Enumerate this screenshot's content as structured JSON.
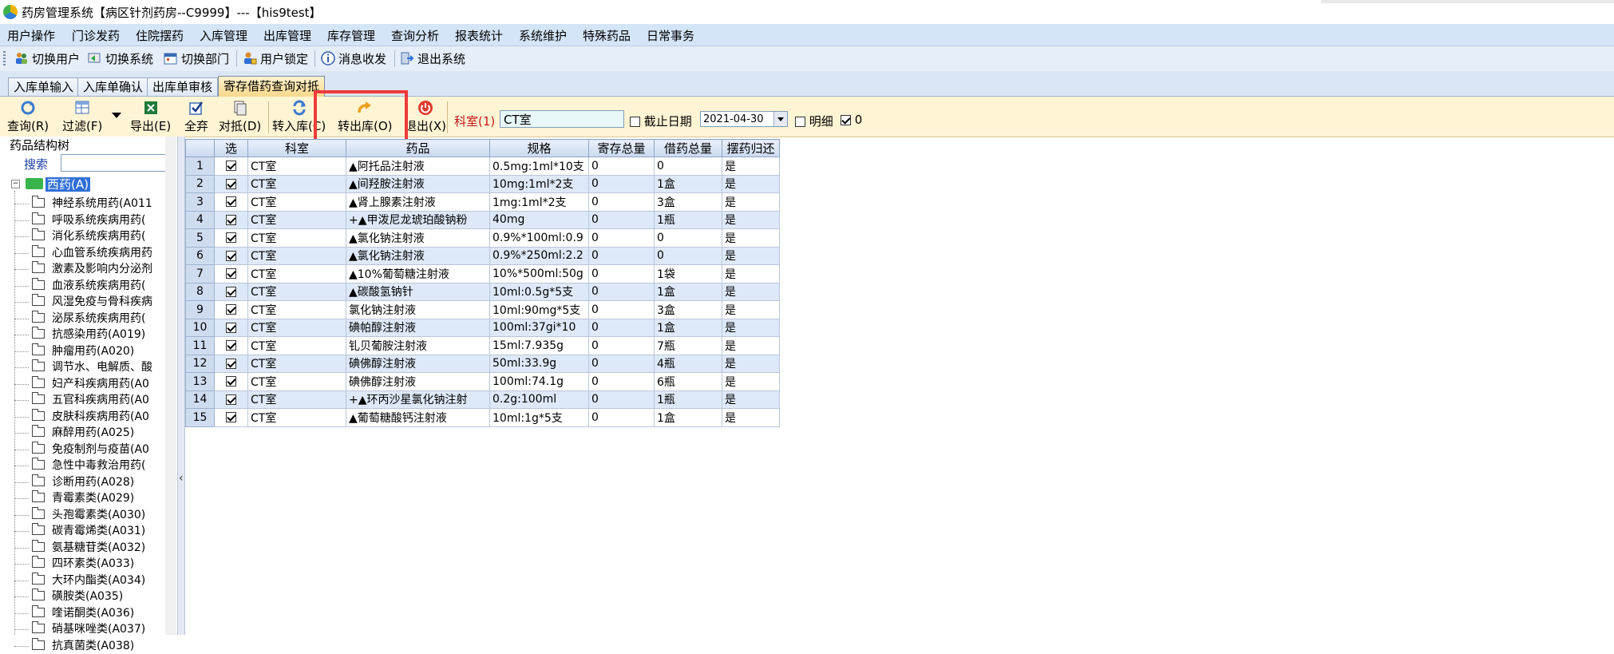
{
  "window": {
    "title": "药房管理系统【病区针剂药房--C9999】---【his9test】"
  },
  "menu": [
    "用户操作",
    "门诊发药",
    "住院摆药",
    "入库管理",
    "出库管理",
    "库存管理",
    "查询分析",
    "报表统计",
    "系统维护",
    "特殊药品",
    "日常事务"
  ],
  "toolbar1": [
    "切换用户",
    "切换系统",
    "切换部门",
    "用户锁定",
    "消息收发",
    "退出系统"
  ],
  "tabs": [
    "入库单输入",
    "入库单确认",
    "出库单审核",
    "寄存借药查询对抵"
  ],
  "toolbar2": {
    "query": "查询(R)",
    "filter": "过滤(F)",
    "export": "导出(E)",
    "select_all": "全弃",
    "reconcile": "对抵(D)",
    "transfer_in": "转入库(C)",
    "transfer_out": "转出库(O)",
    "exit": "退出(X)",
    "dept_label": "科室(1)",
    "dept_value": "CT室",
    "end_date_label": "截止日期",
    "end_date_value": "2021-04-30",
    "detail_label": "明细",
    "zero_label": "0"
  },
  "left_panel": {
    "title": "药品结构树",
    "search_label": "搜索",
    "root": "西药(A)",
    "items": [
      "神经系统用药(A011",
      "呼吸系统疾病用药(",
      "消化系统疾病用药(",
      "心血管系统疾病用药",
      "激素及影响内分泌剂",
      "血液系统疾病用药(",
      "风湿免疫与骨科疾病",
      "泌尿系统疾病用药(",
      "抗感染用药(A019)",
      "肿瘤用药(A020)",
      "调节水、电解质、酸",
      "妇产科疾病用药(A0",
      "五官科疾病用药(A0",
      "皮肤科疾病用药(A0",
      "麻醉用药(A025)",
      "免疫制剂与疫苗(A0",
      "急性中毒救治用药(",
      "诊断用药(A028)",
      "青霉素类(A029)",
      "头孢霉素类(A030)",
      "碳青霉烯类(A031)",
      "氨基糖苷类(A032)",
      "四环素类(A033)",
      "大环内酯类(A034)",
      "磺胺类(A035)",
      "喹诺酮类(A036)",
      "硝基咪唑类(A037)",
      "抗真菌类(A038)"
    ]
  },
  "grid": {
    "columns": [
      "选",
      "科室",
      "药品",
      "规格",
      "寄存总量",
      "借药总量",
      "摆药归还"
    ],
    "rows": [
      [
        "1",
        "CT室",
        "▲阿托品注射液",
        "0.5mg:1ml*10支",
        "0",
        "0",
        "是"
      ],
      [
        "2",
        "CT室",
        "▲间羟胺注射液",
        "10mg:1ml*2支",
        "0",
        "1盒",
        "是"
      ],
      [
        "3",
        "CT室",
        "▲肾上腺素注射液",
        "1mg:1ml*2支",
        "0",
        "3盒",
        "是"
      ],
      [
        "4",
        "CT室",
        "+▲甲泼尼龙琥珀酸钠粉",
        "40mg",
        "0",
        "1瓶",
        "是"
      ],
      [
        "5",
        "CT室",
        "▲氯化钠注射液",
        "0.9%*100ml:0.9",
        "0",
        "0",
        "是"
      ],
      [
        "6",
        "CT室",
        "▲氯化钠注射液",
        "0.9%*250ml:2.2",
        "0",
        "0",
        "是"
      ],
      [
        "7",
        "CT室",
        "▲10%葡萄糖注射液",
        "10%*500ml:50g",
        "0",
        "1袋",
        "是"
      ],
      [
        "8",
        "CT室",
        "▲碳酸氢钠针",
        "10ml:0.5g*5支",
        "0",
        "1盒",
        "是"
      ],
      [
        "9",
        "CT室",
        "氯化钠注射液",
        "10ml:90mg*5支",
        "0",
        "3盒",
        "是"
      ],
      [
        "10",
        "CT室",
        "碘帕醇注射液",
        "100ml:37gi*10",
        "0",
        "1盒",
        "是"
      ],
      [
        "11",
        "CT室",
        "钆贝葡胺注射液",
        "15ml:7.935g",
        "0",
        "7瓶",
        "是"
      ],
      [
        "12",
        "CT室",
        "碘佛醇注射液",
        "50ml:33.9g",
        "0",
        "4瓶",
        "是"
      ],
      [
        "13",
        "CT室",
        "碘佛醇注射液",
        "100ml:74.1g",
        "0",
        "6瓶",
        "是"
      ],
      [
        "14",
        "CT室",
        "+▲环丙沙星氯化钠注射",
        "0.2g:100ml",
        "0",
        "1瓶",
        "是"
      ],
      [
        "15",
        "CT室",
        "▲葡萄糖酸钙注射液",
        "10ml:1g*5支",
        "0",
        "1盒",
        "是"
      ]
    ]
  }
}
